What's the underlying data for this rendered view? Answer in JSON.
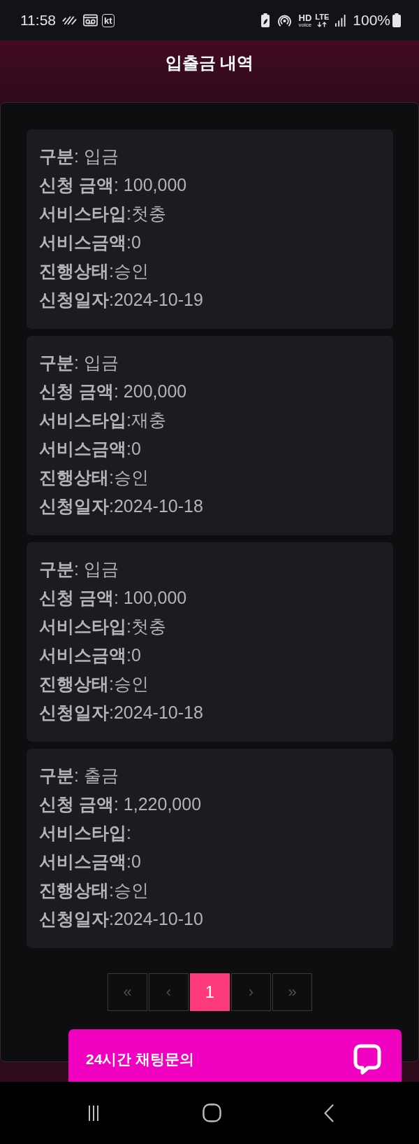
{
  "status_bar": {
    "time": "11:58",
    "carrier": "kt",
    "hd": "HD",
    "voice": "voice",
    "network": "LTE",
    "battery": "100%"
  },
  "header": {
    "title": "입출금 내역"
  },
  "records": [
    {
      "fields": [
        "**구분**: 입금",
        "**신청 금액**: 100,000",
        "**서비스타입**:첫충",
        "**서비스금액**:0",
        "**진행상태**:승인",
        "**신청일자**:2024-10-19"
      ]
    },
    {
      "fields": [
        "**구분**: 입금",
        "**신청 금액**: 200,000",
        "**서비스타입**:재충",
        "**서비스금액**:0",
        "**진행상태**:승인",
        "**신청일자**:2024-10-18"
      ]
    },
    {
      "fields": [
        "**구분**: 입금",
        "**신청 금액**: 100,000",
        "**서비스타입**:첫충",
        "**서비스금액**:0",
        "**진행상태**:승인",
        "**신청일자**:2024-10-18"
      ]
    },
    {
      "fields": [
        "**구분**: 출금",
        "**신청 금액**: 1,220,000",
        "**서비스타입**:",
        "**서비스금액**:0",
        "**진행상태**:승인",
        "**신청일자**:2024-10-10"
      ]
    }
  ],
  "pagination": {
    "items": [
      {
        "kind": "first",
        "label": "«",
        "selected": false
      },
      {
        "kind": "prev",
        "label": "‹",
        "selected": false
      },
      {
        "kind": "page",
        "label": "1",
        "selected": true
      },
      {
        "kind": "next",
        "label": "›",
        "selected": false
      },
      {
        "kind": "last",
        "label": "»",
        "selected": false
      }
    ]
  },
  "chat_button": {
    "label": "24시간 채팅문의"
  }
}
